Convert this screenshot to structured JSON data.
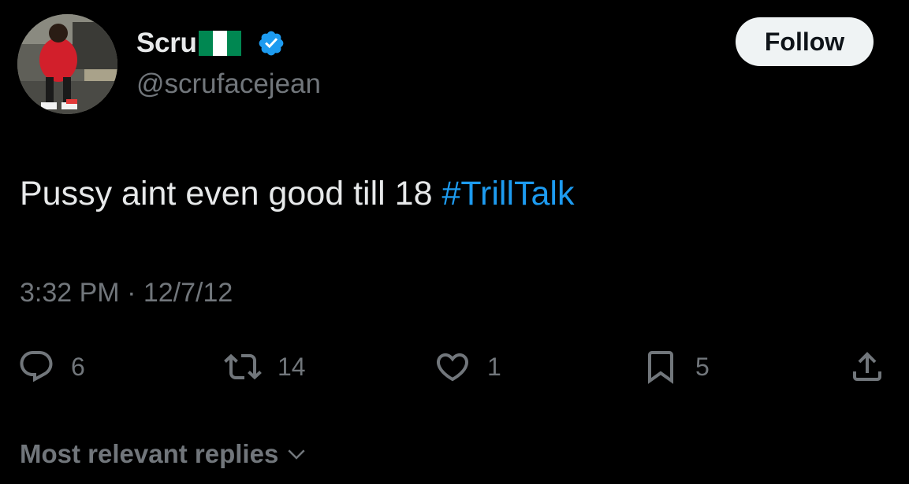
{
  "user": {
    "display_name": "Scru",
    "handle": "@scrufacejean",
    "flag": "nigeria-flag-icon",
    "verified": "verified-badge-icon"
  },
  "follow_button": {
    "label": "Follow"
  },
  "tweet": {
    "text": "Pussy aint even good till 18 ",
    "hashtag": "#TrillTalk",
    "timestamp": "3:32 PM · 12/7/12"
  },
  "actions": {
    "reply": {
      "icon": "reply-icon",
      "count": "6"
    },
    "retweet": {
      "icon": "retweet-icon",
      "count": "14"
    },
    "like": {
      "icon": "heart-icon",
      "count": "1"
    },
    "bookmark": {
      "icon": "bookmark-icon",
      "count": "5"
    },
    "share": {
      "icon": "share-icon"
    }
  },
  "replies_filter": {
    "label": "Most relevant replies",
    "icon": "chevron-down-icon"
  },
  "colors": {
    "background": "#000000",
    "primary_text": "#e7e9ea",
    "secondary_text": "#71767b",
    "link": "#1d9bf0",
    "verified": "#1d9bf0",
    "follow_bg": "#eff3f4",
    "flag_green": "#008751",
    "flag_white": "#ffffff"
  }
}
